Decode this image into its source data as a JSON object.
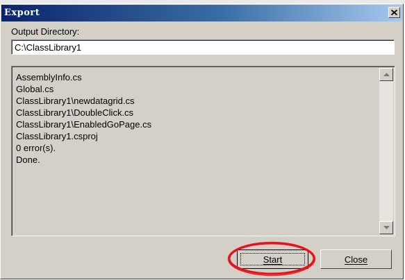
{
  "window": {
    "title": "Export"
  },
  "output": {
    "label": "Output Directory:",
    "value": "C:\\ClassLibrary1"
  },
  "log": {
    "lines": [
      "AssemblyInfo.cs",
      "Global.cs",
      "ClassLibrary1\\newdatagrid.cs",
      "ClassLibrary1\\DoubleClick.cs",
      "ClassLibrary1\\EnabledGoPage.cs",
      "ClassLibrary1.csproj",
      "0 error(s).",
      "Done."
    ]
  },
  "buttons": {
    "start_label": "Start",
    "close_label": "Close"
  },
  "colors": {
    "titlebar_start": "#0a246a",
    "titlebar_end": "#a6caf0",
    "dialog_face": "#d4d0c8",
    "annotation_ring": "#e8101a"
  },
  "icons": {
    "close": "close-icon",
    "scroll_up": "scroll-up-arrow-icon",
    "scroll_down": "scroll-down-arrow-icon"
  }
}
